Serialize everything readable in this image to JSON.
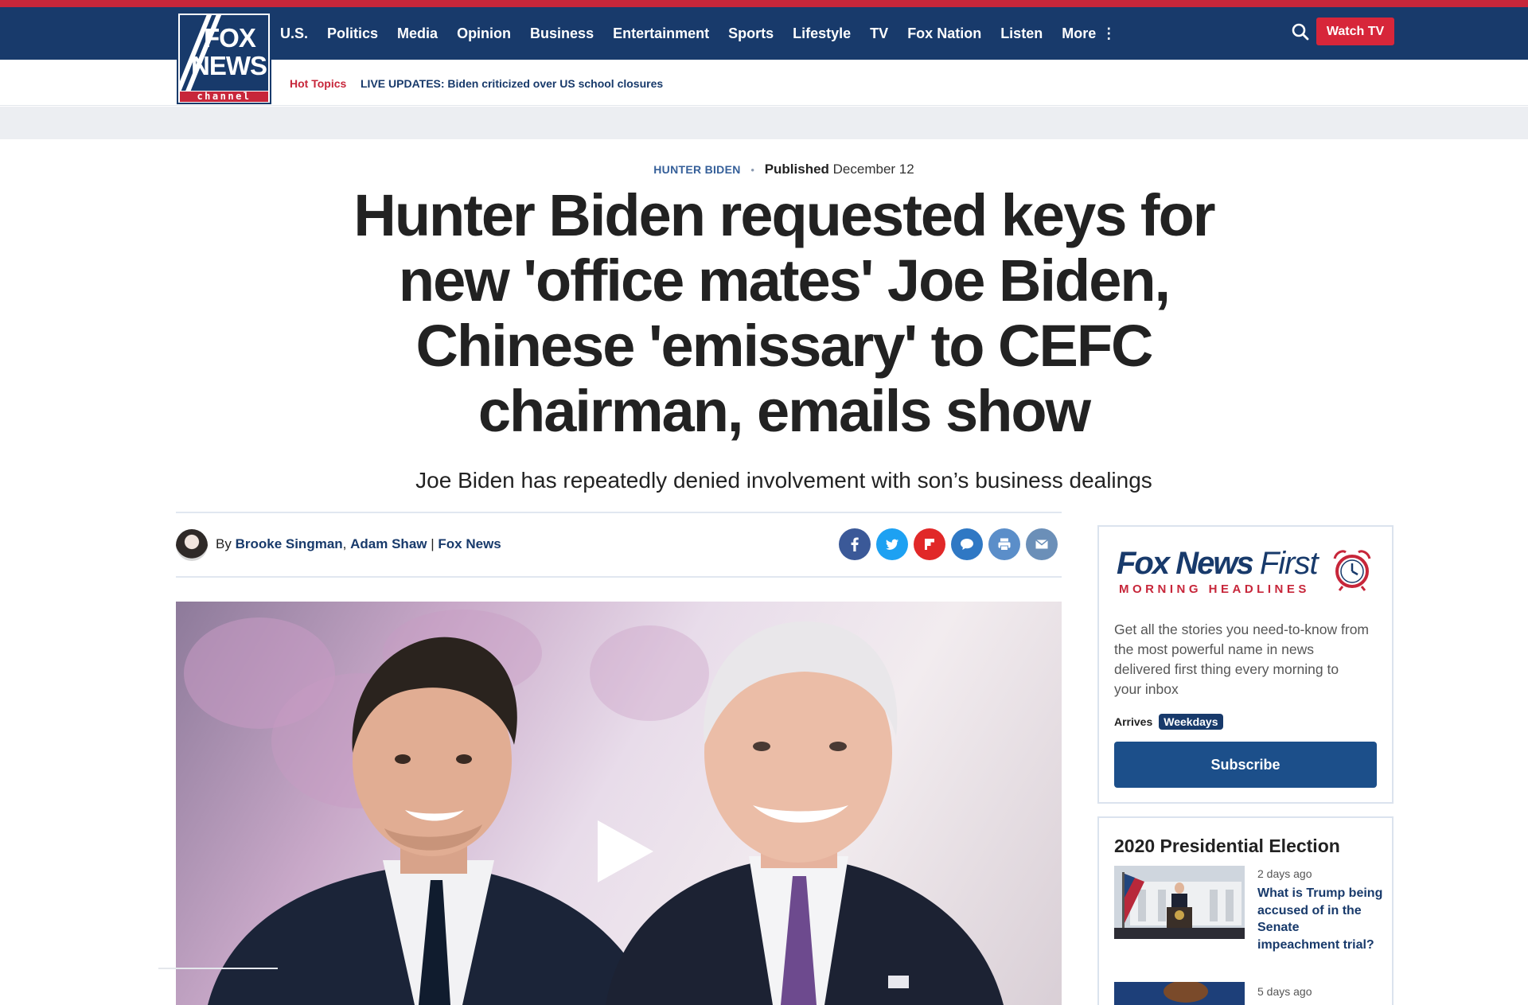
{
  "brand": {
    "logo_fox": "FOX",
    "logo_news": "NEWS",
    "logo_channel": "channel",
    "colors": {
      "navy": "#183a6b",
      "red": "#c7263a",
      "button_blue": "#1c4f8a"
    }
  },
  "nav": {
    "items": [
      "U.S.",
      "Politics",
      "Media",
      "Opinion",
      "Business",
      "Entertainment",
      "Sports",
      "Lifestyle",
      "TV",
      "Fox Nation",
      "Listen"
    ],
    "more_label": "More",
    "more_icon": "vertical-dots-icon",
    "search_icon": "search-icon",
    "watch_tv_label": "Watch TV"
  },
  "hot_topics": {
    "label": "Hot Topics",
    "link": "LIVE UPDATES: Biden criticized over US school closures"
  },
  "article": {
    "category": "HUNTER BIDEN",
    "published_label": "Published",
    "published_date": "December 12",
    "headline": "Hunter Biden requested keys for new 'office mates' Joe Biden, Chinese 'emissary' to CEFC chairman, emails show",
    "dek": "Joe Biden has repeatedly denied involvement with son’s business dealings",
    "byline_prefix": "By",
    "authors": [
      "Brooke Singman",
      "Adam Shaw"
    ],
    "author_separator": ",",
    "source_separator": "|",
    "source": "Fox News",
    "share_icons": [
      {
        "name": "facebook-icon",
        "color": "#3b5998"
      },
      {
        "name": "twitter-icon",
        "color": "#1da1f2"
      },
      {
        "name": "flipboard-icon",
        "color": "#e12828"
      },
      {
        "name": "comment-icon",
        "color": "#2f78c4"
      },
      {
        "name": "print-icon",
        "color": "#5b8ec9"
      },
      {
        "name": "email-icon",
        "color": "#6b8fb8"
      }
    ],
    "video_icon": "play-icon"
  },
  "newsletter": {
    "title_bold": "Fox News",
    "title_light": "First",
    "subtitle": "MORNING HEADLINES",
    "icon": "alarm-clock-icon",
    "description": "Get all the stories you need-to-know from the most powerful name in news delivered first thing every morning to your inbox",
    "arrives_label": "Arrives",
    "arrives_value": "Weekdays",
    "subscribe_label": "Subscribe"
  },
  "election": {
    "title": "2020 Presidential Election",
    "items": [
      {
        "time": "2 days ago",
        "headline": "What is Trump being accused of in the Senate impeachment trial?"
      },
      {
        "time": "5 days ago",
        "headline": ""
      }
    ]
  }
}
